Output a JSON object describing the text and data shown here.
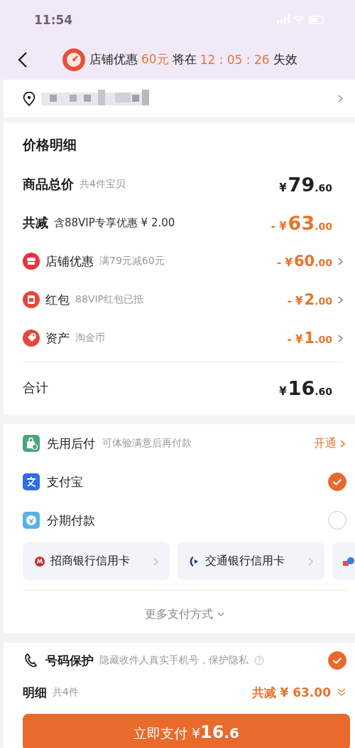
{
  "status_bar": {
    "time": "11:54"
  },
  "nav": {
    "parts": [
      {
        "text": "店铺优惠",
        "highlight": false
      },
      {
        "text": "60元",
        "highlight": true
      },
      {
        "text": "将在",
        "highlight": false
      },
      {
        "text": "12 : 05 : 26",
        "highlight": true
      },
      {
        "text": "失效",
        "highlight": false
      }
    ]
  },
  "address": {
    "redacted": true
  },
  "price_detail": {
    "title": "价格明细",
    "rows": [
      {
        "kind": "summary",
        "label": "商品总价",
        "note": "共4件宝贝",
        "sign": "¥",
        "int": "79",
        "dec": ".60",
        "discount": false
      },
      {
        "kind": "summary",
        "label": "共减",
        "note": "含88VIP专享优惠 ¥ 2.00",
        "sign": "- ¥",
        "int": "63",
        "dec": ".00",
        "discount": true
      },
      {
        "kind": "store",
        "label": "店铺优惠",
        "note": "满79元减60元",
        "sign": "- ¥",
        "int": "60",
        "dec": ".00",
        "discount": true
      },
      {
        "kind": "redpacket",
        "label": "红包",
        "note": "88VIP红包已抵",
        "sign": "- ¥",
        "int": "2",
        "dec": ".00",
        "discount": true
      },
      {
        "kind": "asset",
        "label": "资产",
        "note": "淘金币",
        "sign": "- ¥",
        "int": "1",
        "dec": ".00",
        "discount": true
      }
    ],
    "total": {
      "label": "合计",
      "sign": "¥",
      "int": "16",
      "dec": ".60"
    }
  },
  "payment": {
    "methods": [
      {
        "kind": "later",
        "label": "先用后付",
        "note": "可体验满意后再付款",
        "action": "开通"
      },
      {
        "kind": "alipay",
        "label": "支付宝",
        "selected": true
      },
      {
        "kind": "installment",
        "label": "分期付款",
        "selected": false
      }
    ],
    "cards": [
      {
        "kind": "cmb",
        "label": "招商银行信用卡"
      },
      {
        "kind": "bocom",
        "label": "交通银行信用卡"
      },
      {
        "kind": "other"
      }
    ],
    "more": "更多支付方式"
  },
  "protection": {
    "label": "号码保护",
    "note": "隐藏收件人真实手机号，保护隐私",
    "checked": true
  },
  "summary": {
    "label": "明细",
    "count": "共4件",
    "reduction": "共减 ¥ 63.00"
  },
  "pay_button": {
    "label": "立即支付",
    "sign": "¥",
    "int": "16",
    "dec": ".6"
  }
}
